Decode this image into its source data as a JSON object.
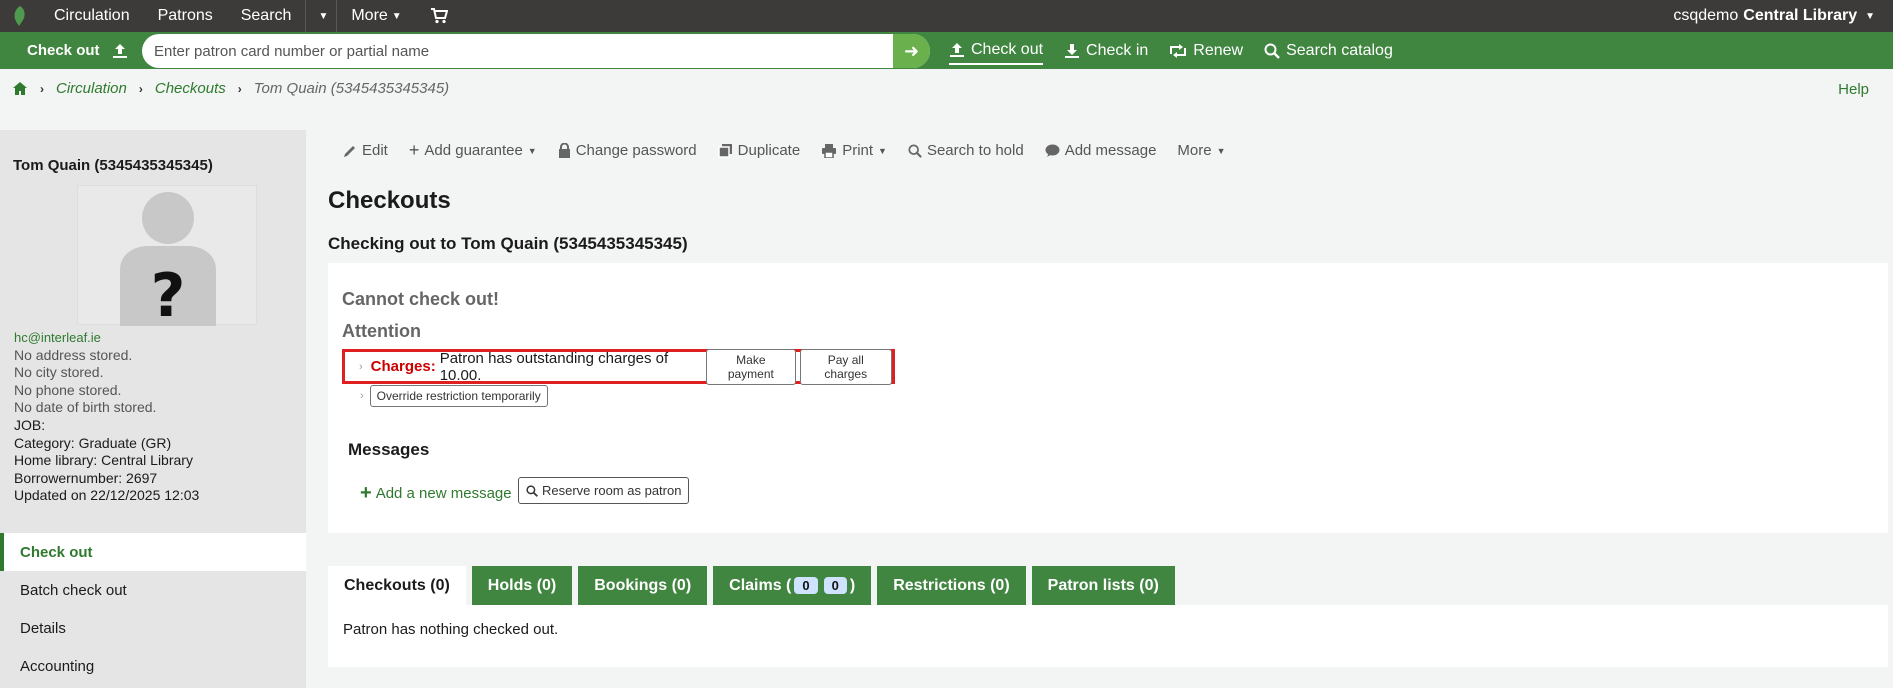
{
  "topnav": {
    "items": [
      "Circulation",
      "Patrons",
      "Search",
      "More"
    ],
    "user_prefix": "csqdemo",
    "library": "Central Library"
  },
  "greenbar": {
    "checkout_label": "Check out",
    "search_placeholder": "Enter patron card number or partial name",
    "actions": [
      "Check out",
      "Check in",
      "Renew",
      "Search catalog"
    ]
  },
  "breadcrumb": [
    "Circulation",
    "Checkouts",
    "Tom Quain (5345435345345)"
  ],
  "help": "Help",
  "sidebar": {
    "patron_name": "Tom Quain (5345435345345)",
    "email": "hc@interleaf.ie",
    "address": "No address stored.",
    "city": "No city stored.",
    "phone": "No phone stored.",
    "dob": "No date of birth stored.",
    "job": "JOB:",
    "category": "Category: Graduate (GR)",
    "home_library": "Home library: Central Library",
    "borrowernumber": "Borrowernumber: 2697",
    "updated": "Updated on 22/12/2025 12:03",
    "menu": [
      "Check out",
      "Batch check out",
      "Details",
      "Accounting"
    ]
  },
  "toolbar": [
    "Edit",
    "Add guarantee",
    "Change password",
    "Duplicate",
    "Print",
    "Search to hold",
    "Add message",
    "More"
  ],
  "main": {
    "title": "Checkouts",
    "subtitle": "Checking out to Tom Quain (5345435345345)",
    "cannot": "Cannot check out!",
    "attention": "Attention",
    "charges_label": "Charges:",
    "charges_text": "Patron has outstanding charges of 10.00.",
    "make_payment": "Make payment",
    "pay_all": "Pay all charges",
    "override": "Override restriction temporarily",
    "messages": "Messages",
    "add_message": "Add a new message",
    "reserve_room": "Reserve room as patron"
  },
  "tabs": {
    "checkouts": "Checkouts (0)",
    "holds": "Holds (0)",
    "bookings": "Bookings (0)",
    "claims_prefix": "Claims (",
    "claims_a": "0",
    "claims_b": "0",
    "claims_suffix": ")",
    "restrictions": "Restrictions (0)",
    "patron_lists": "Patron lists (0)",
    "empty": "Patron has nothing checked out."
  },
  "colors": {
    "green": "#408540",
    "nav": "#3d3a3a",
    "alert_border": "#e02020"
  }
}
